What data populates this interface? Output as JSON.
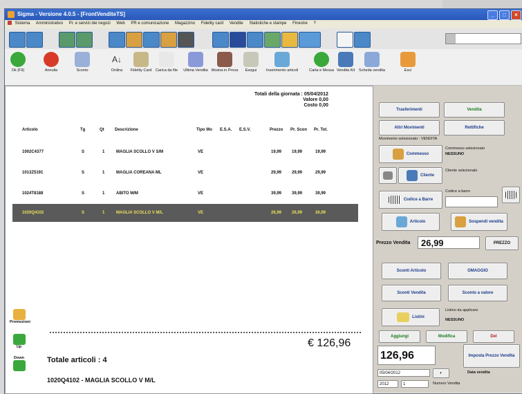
{
  "title": "Sigma - Versione 4.0.5 - [FrontVenditeTS]",
  "menu": [
    "Sistema",
    "Amministrativo",
    "Pr. e servizi dei negozi",
    "Web",
    "PR e comunicazione",
    "Magazzino",
    "Fidelity card",
    "Vendite",
    "Statistiche e stampe",
    "Finestre",
    "?"
  ],
  "toolbar2": [
    "Ok (F9)",
    "Annulla",
    "Sconto",
    "Ordina",
    "Fidelity Card",
    "Carica da file",
    "Ultima Vendita",
    "Mostra in Prova",
    "Esegui",
    "Inserimento articoli",
    "Carta e Messa",
    "Vendita Kit",
    "Scheda vendita",
    "Esci"
  ],
  "totals": {
    "line1": "Totali della giornata : 05/04/2012",
    "line2": "Valore 0,00",
    "line3": "Costo 0,00"
  },
  "columns": [
    "Articolo",
    "Tg",
    "Qt",
    "Descrizione",
    "Tipo Mo",
    "E.S.A.",
    "E.S.V.",
    "Prezzo",
    "Pr. Scon",
    "Pr. Tot."
  ],
  "rows": [
    {
      "articolo": "1002C4377",
      "tg": "S",
      "qt": "1",
      "descrizione": "MAGLIA SCOLLO V S/M",
      "tipo": "VE",
      "prezzo": "19,99",
      "scon": "19,99",
      "tot": "19,99"
    },
    {
      "articolo": "1013Z5191",
      "tg": "S",
      "qt": "1",
      "descrizione": "MAGLIA COREANA ML",
      "tipo": "VE",
      "prezzo": "29,99",
      "scon": "29,99",
      "tot": "29,99"
    },
    {
      "articolo": "1024T8188",
      "tg": "S",
      "qt": "1",
      "descrizione": "ABITO M/M",
      "tipo": "VE",
      "prezzo": "39,99",
      "scon": "39,99",
      "tot": "39,99"
    },
    {
      "articolo": "1020Q4102",
      "tg": "S",
      "qt": "1",
      "descrizione": "MAGLIA SCOLLO V M/L",
      "tipo": "VE",
      "prezzo": "26,99",
      "scon": "26,99",
      "tot": "26,99"
    }
  ],
  "side": {
    "promo": "Promozioni",
    "up": "Up",
    "down": "Down"
  },
  "total_amount": "€ 126,96",
  "totale_articoli": "Totale articoli : 4",
  "last_article": "1020Q4102 - MAGLIA SCOLLO V M/L",
  "right": {
    "trasferimenti": "Trasferimenti",
    "vendita": "Vendita",
    "altri_mov": "Altri Movimenti",
    "rettifiche": "Rettifiche",
    "mov_sel": "Movimento selezionato : VENDITA",
    "commesso": "Commesso",
    "commesso_label": "Commesso selezionato",
    "commesso_val": "NESSUNO",
    "cliente": "Cliente",
    "cliente_label": "Cliente selezionato",
    "codice_barre": "Codice a Barre",
    "codice_label": "Codice a barre",
    "articolo": "Articolo",
    "sospendi": "Sospendi vendita",
    "prezzo_label": "Prezzo Vendita",
    "prezzo_val": "26,99",
    "prezzo_btn": "PREZZO",
    "sconti_art": "Sconti Articolo",
    "omaggio": "OMAGGIO",
    "sconti_vend": "Sconti Vendita",
    "sconto_valore": "Sconto a valore",
    "listini": "Listini",
    "listino_label": "Listino da applicare",
    "listino_val": "NESSUNO",
    "aggiungi": "Aggiungi",
    "modifica": "Modifica",
    "del": "Del",
    "amount": "126,96",
    "imposta": "Imposta Prezzo Vendita",
    "date": "05/04/2012",
    "data_label": "Data vendita",
    "year": "2012",
    "num": "1",
    "numero_label": "Numero Vendita"
  },
  "colors": {
    "title": "#2a58b8",
    "selected_row": "#5a5a5a",
    "selected_text": "#e8e05a"
  }
}
